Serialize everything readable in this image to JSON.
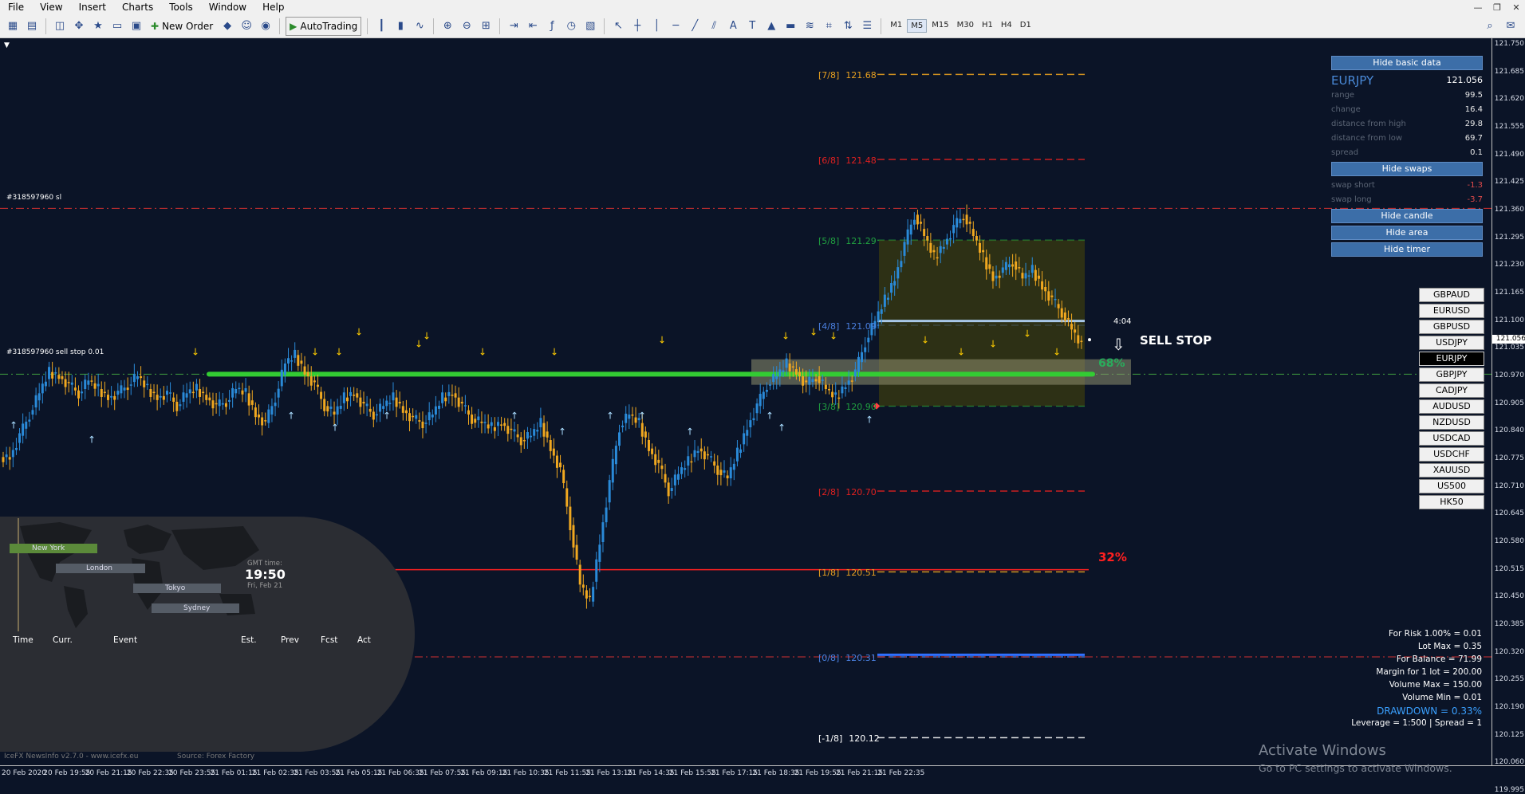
{
  "menu": [
    "File",
    "View",
    "Insert",
    "Charts",
    "Tools",
    "Window",
    "Help"
  ],
  "window_controls": [
    "—",
    "❐",
    "✕"
  ],
  "toolbar": {
    "new_order": "New Order",
    "autotrading": "AutoTrading",
    "timeframes": [
      "M1",
      "M5",
      "M15",
      "M30",
      "H1",
      "H4",
      "D1"
    ],
    "active_tf": "M5"
  },
  "chart": {
    "symbol": "EURJPY",
    "price_axis": [
      "121.750",
      "121.685",
      "121.620",
      "121.555",
      "121.490",
      "121.425",
      "121.360",
      "121.295",
      "121.230",
      "121.165",
      "121.100",
      "121.035",
      "120.970",
      "120.905",
      "120.840",
      "120.775",
      "120.710",
      "120.645",
      "120.580",
      "120.515",
      "120.450",
      "120.385",
      "120.320",
      "120.255",
      "120.190",
      "120.125",
      "120.060",
      "119.995"
    ],
    "current_price_tag": "121.056",
    "time_axis": [
      "20 Feb 2020",
      "20 Feb 19:55",
      "20 Feb 21:15",
      "20 Feb 22:35",
      "20 Feb 23:55",
      "21 Feb 01:15",
      "21 Feb 02:35",
      "21 Feb 03:55",
      "21 Feb 05:15",
      "21 Feb 06:35",
      "21 Feb 07:55",
      "21 Feb 09:15",
      "21 Feb 10:35",
      "21 Feb 11:55",
      "21 Feb 13:15",
      "21 Feb 14:35",
      "21 Feb 15:55",
      "21 Feb 17:15",
      "21 Feb 18:35",
      "21 Feb 19:55",
      "21 Feb 21:15",
      "21 Feb 22:35"
    ],
    "murrey_levels": [
      {
        "label": "[7/8]",
        "price": "121.68",
        "color": "#e8a020"
      },
      {
        "label": "[6/8]",
        "price": "121.48",
        "color": "#e02020"
      },
      {
        "label": "[5/8]",
        "price": "121.29",
        "color": "#20a040"
      },
      {
        "label": "[4/8]",
        "price": "121.09",
        "color": "#4a80e0"
      },
      {
        "label": "[3/8]",
        "price": "120.90",
        "color": "#20a040"
      },
      {
        "label": "[2/8]",
        "price": "120.70",
        "color": "#e02020"
      },
      {
        "label": "[1/8]",
        "price": "120.51",
        "color": "#e8a020"
      },
      {
        "label": "[0/8]",
        "price": "120.31",
        "color": "#4a80e0"
      },
      {
        "label": "[-1/8]",
        "price": "120.12",
        "color": "#ffffff"
      }
    ],
    "order_sl": "#318597960 sl",
    "order_entry": "#318597960 sell stop 0.01",
    "sell_stop_label": "SELL STOP",
    "timer": "4:04",
    "pct_upper": "68%",
    "pct_lower": "32%"
  },
  "basic_data": {
    "hide_basic": "Hide basic data",
    "symbol": "EURJPY",
    "price": "121.056",
    "rows": [
      {
        "k": "range",
        "v": "99.5"
      },
      {
        "k": "change",
        "v": "16.4"
      },
      {
        "k": "distance from high",
        "v": "29.8"
      },
      {
        "k": "distance from low",
        "v": "69.7"
      },
      {
        "k": "spread",
        "v": "0.1"
      }
    ],
    "hide_swaps": "Hide swaps",
    "swaps": [
      {
        "k": "swap short",
        "v": "-1.3"
      },
      {
        "k": "swap long",
        "v": "-3.7"
      }
    ],
    "hide_candle": "Hide candle",
    "hide_area": "Hide area",
    "hide_timer": "Hide timer"
  },
  "symbols": [
    "GBPAUD",
    "EURUSD",
    "GBPUSD",
    "USDJPY",
    "EURJPY",
    "GBPJPY",
    "CADJPY",
    "AUDUSD",
    "NZDUSD",
    "USDCAD",
    "USDCHF",
    "XAUUSD",
    "US500",
    "HK50"
  ],
  "active_symbol": "EURJPY",
  "risk": {
    "lines": [
      "For Risk 1.00% = 0.01",
      "Lot Max = 0.35",
      "For Balance = 71.99",
      "Margin for 1 lot = 200.00",
      "Volume Max = 150.00",
      "Volume Min = 0.01"
    ],
    "drawdown": "DRAWDOWN =  0.33%",
    "leverage": "Leverage = 1:500 | Spread = 1"
  },
  "news": {
    "sessions": [
      "New York",
      "London",
      "Tokyo",
      "Sydney"
    ],
    "gmt_label": "GMT time:",
    "gmt_time": "19:50",
    "gmt_date": "Fri, Feb 21",
    "columns": [
      "Time",
      "Curr.",
      "Event",
      "Est.",
      "Prev",
      "Fcst",
      "Act"
    ],
    "footer": "IceFX NewsInfo v2.7.0 -  www.icefx.eu",
    "source": "Source: Forex Factory"
  },
  "watermark": {
    "title": "Activate Windows",
    "sub": "Go to PC settings to activate Windows."
  }
}
